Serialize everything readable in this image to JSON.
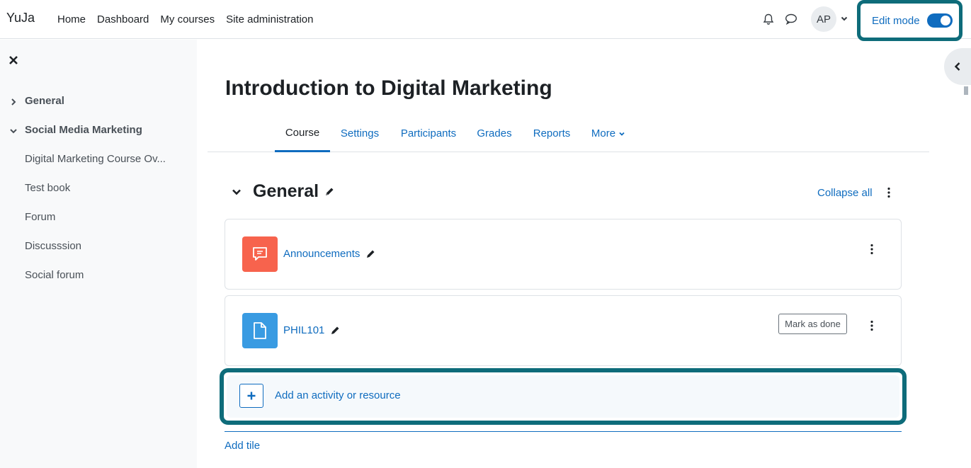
{
  "brand": "YuJa",
  "primary_nav": [
    "Home",
    "Dashboard",
    "My courses",
    "Site administration"
  ],
  "user": {
    "initials": "AP"
  },
  "edit_mode": {
    "label": "Edit mode",
    "enabled": true
  },
  "drawer": {
    "sections": [
      {
        "label": "General",
        "expanded": false
      },
      {
        "label": "Social Media Marketing",
        "expanded": true
      }
    ],
    "items": [
      "Digital Marketing Course Ov...",
      "Test book",
      "Forum",
      "Discusssion",
      "Social forum"
    ]
  },
  "course": {
    "title": "Introduction to Digital Marketing"
  },
  "secondary_nav": {
    "tabs": [
      "Course",
      "Settings",
      "Participants",
      "Grades",
      "Reports",
      "More"
    ],
    "active": "Course"
  },
  "section": {
    "title": "General",
    "collapse_all": "Collapse all"
  },
  "activities": [
    {
      "name": "Announcements",
      "icon": "forum-icon",
      "color": "#f7634d"
    },
    {
      "name": "PHIL101",
      "icon": "page-icon",
      "color": "#399be2",
      "completion": "Mark as done"
    }
  ],
  "add_activity": "Add an activity or resource",
  "add_tile": "Add tile",
  "colors": {
    "accent": "#0f6cbf",
    "highlight": "#0e6c7a"
  }
}
